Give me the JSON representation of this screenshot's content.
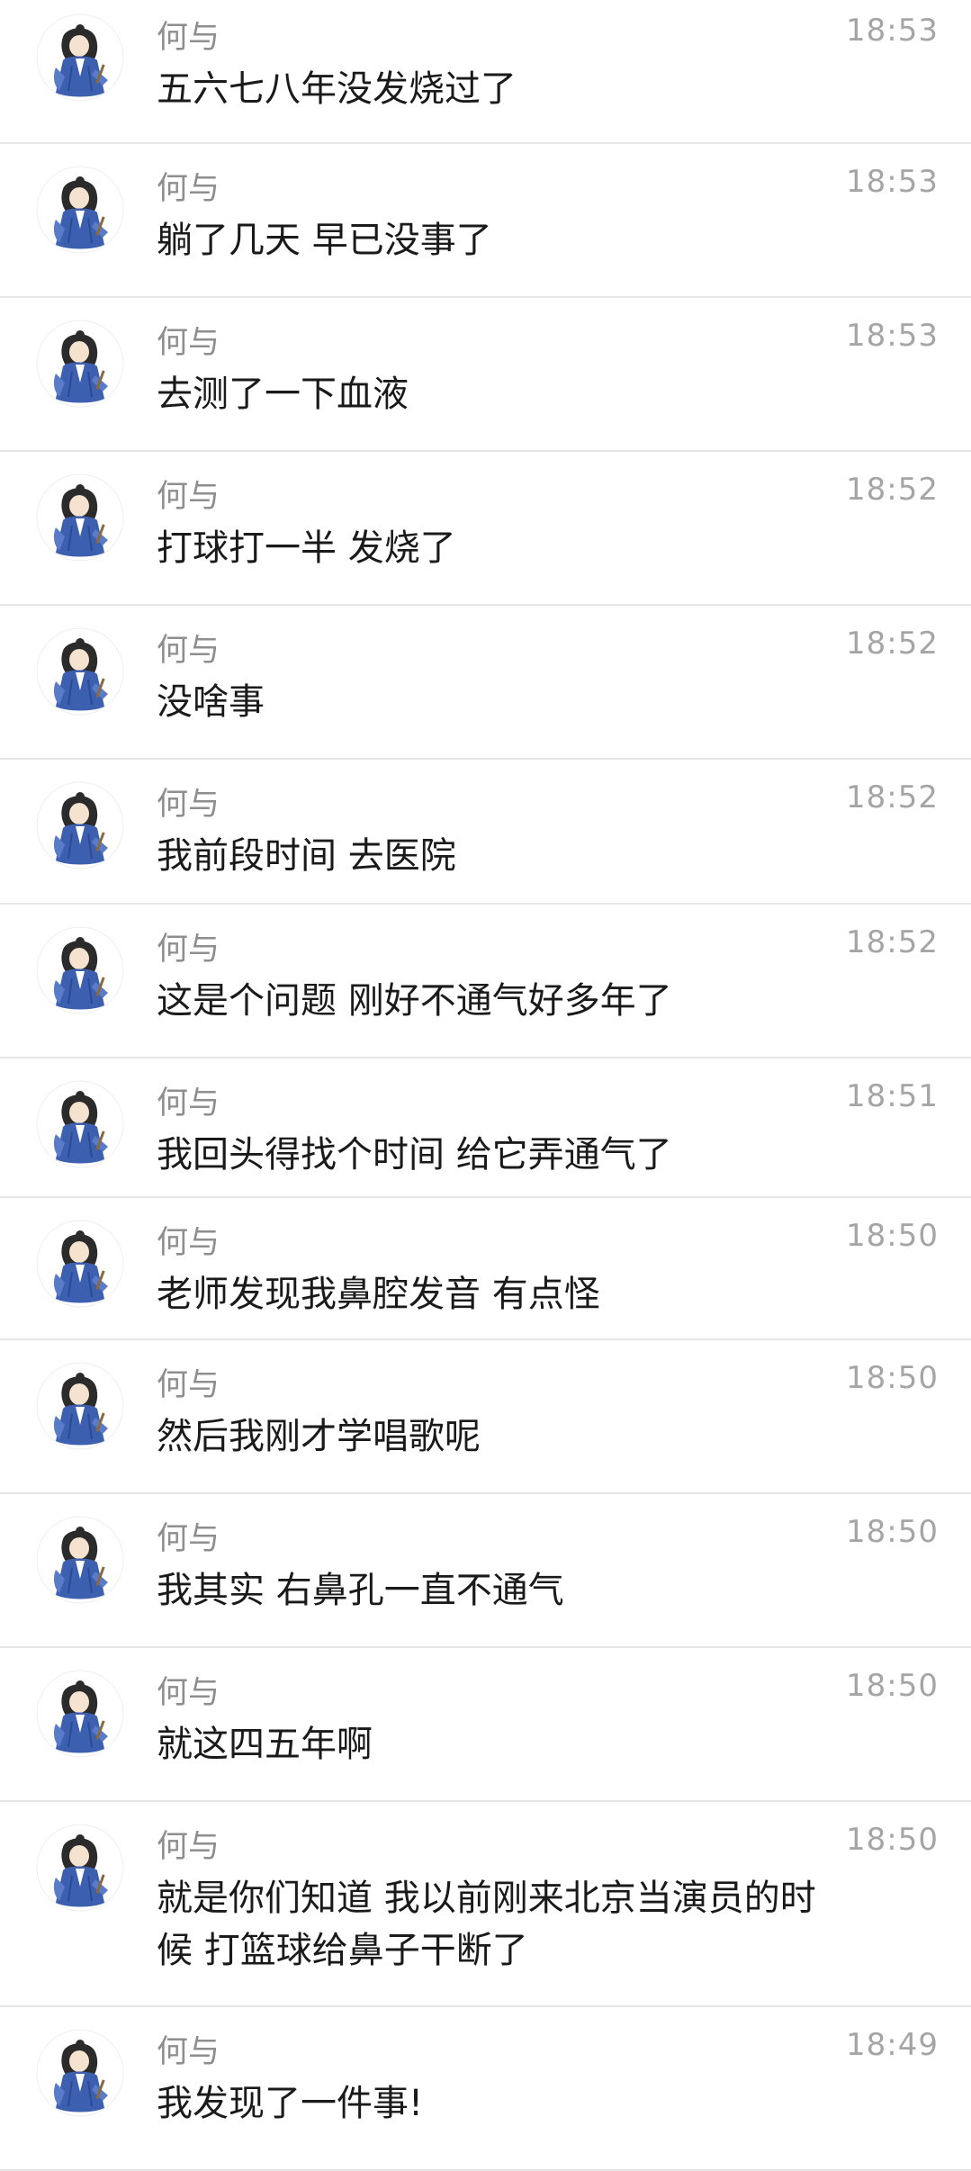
{
  "contact_name": "何与",
  "avatar_icon": "anime-character-avatar-icon",
  "colors": {
    "background": "#ffffff",
    "divider": "#e6e6e6",
    "name": "#8e8e8e",
    "time": "#a5a5a5",
    "text": "#1a1a1a",
    "avatar_robe": "#3d5fb0"
  },
  "messages": [
    {
      "name": "何与",
      "time": "18:53",
      "text": "五六七八年没发烧过了"
    },
    {
      "name": "何与",
      "time": "18:53",
      "text": "躺了几天 早已没事了"
    },
    {
      "name": "何与",
      "time": "18:53",
      "text": "去测了一下血液"
    },
    {
      "name": "何与",
      "time": "18:52",
      "text": "打球打一半 发烧了"
    },
    {
      "name": "何与",
      "time": "18:52",
      "text": "没啥事"
    },
    {
      "name": "何与",
      "time": "18:52",
      "text": "我前段时间 去医院"
    },
    {
      "name": "何与",
      "time": "18:52",
      "text": "这是个问题 刚好不通气好多年了"
    },
    {
      "name": "何与",
      "time": "18:51",
      "text": "我回头得找个时间 给它弄通气了"
    },
    {
      "name": "何与",
      "time": "18:50",
      "text": "老师发现我鼻腔发音 有点怪"
    },
    {
      "name": "何与",
      "time": "18:50",
      "text": "然后我刚才学唱歌呢"
    },
    {
      "name": "何与",
      "time": "18:50",
      "text": "我其实 右鼻孔一直不通气"
    },
    {
      "name": "何与",
      "time": "18:50",
      "text": "就这四五年啊"
    },
    {
      "name": "何与",
      "time": "18:50",
      "text": "就是你们知道 我以前刚来北京当演员的时候 打篮球给鼻子干断了"
    },
    {
      "name": "何与",
      "time": "18:49",
      "text": "我发现了一件事!"
    }
  ]
}
